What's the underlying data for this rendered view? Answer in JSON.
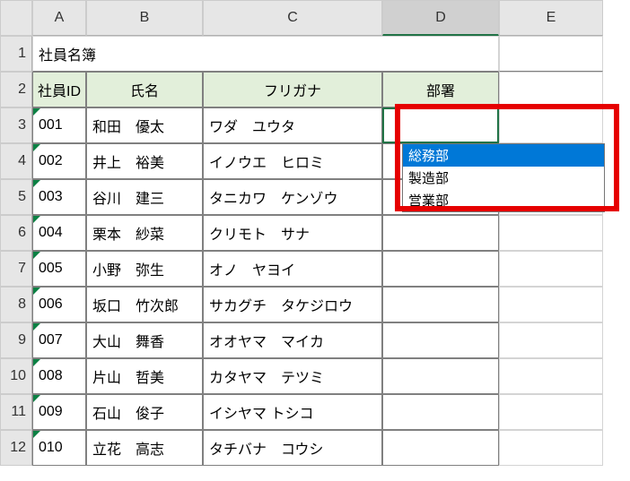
{
  "columns": [
    "A",
    "B",
    "C",
    "D",
    "E"
  ],
  "selected_column_index": 3,
  "row_numbers": [
    "1",
    "2",
    "3",
    "4",
    "5",
    "6",
    "7",
    "8",
    "9",
    "10",
    "11",
    "12"
  ],
  "title": "社員名簿",
  "headers": {
    "id": "社員ID",
    "name": "氏名",
    "furigana": "フリガナ",
    "dept": "部署"
  },
  "rows": [
    {
      "id": "001",
      "name": "和田　優太",
      "furigana": "ワダ　ユウタ",
      "dept": ""
    },
    {
      "id": "002",
      "name": "井上　裕美",
      "furigana": "イノウエ　ヒロミ",
      "dept": ""
    },
    {
      "id": "003",
      "name": "谷川　建三",
      "furigana": "タニカワ　ケンゾウ",
      "dept": ""
    },
    {
      "id": "004",
      "name": "栗本　紗菜",
      "furigana": "クリモト　サナ",
      "dept": ""
    },
    {
      "id": "005",
      "name": "小野　弥生",
      "furigana": "オノ　ヤヨイ",
      "dept": ""
    },
    {
      "id": "006",
      "name": "坂口　竹次郎",
      "furigana": "サカグチ　タケジロウ",
      "dept": ""
    },
    {
      "id": "007",
      "name": "大山　舞香",
      "furigana": "オオヤマ　マイカ",
      "dept": ""
    },
    {
      "id": "008",
      "name": "片山　哲美",
      "furigana": "カタヤマ　テツミ",
      "dept": ""
    },
    {
      "id": "009",
      "name": "石山　俊子",
      "furigana": "イシヤマ トシコ",
      "dept": ""
    },
    {
      "id": "010",
      "name": "立花　高志",
      "furigana": "タチバナ　コウシ",
      "dept": ""
    }
  ],
  "active_cell": {
    "col": 3,
    "row": 2
  },
  "dropdown": {
    "items": [
      "総務部",
      "製造部",
      "営業部"
    ],
    "selected_index": 0
  }
}
